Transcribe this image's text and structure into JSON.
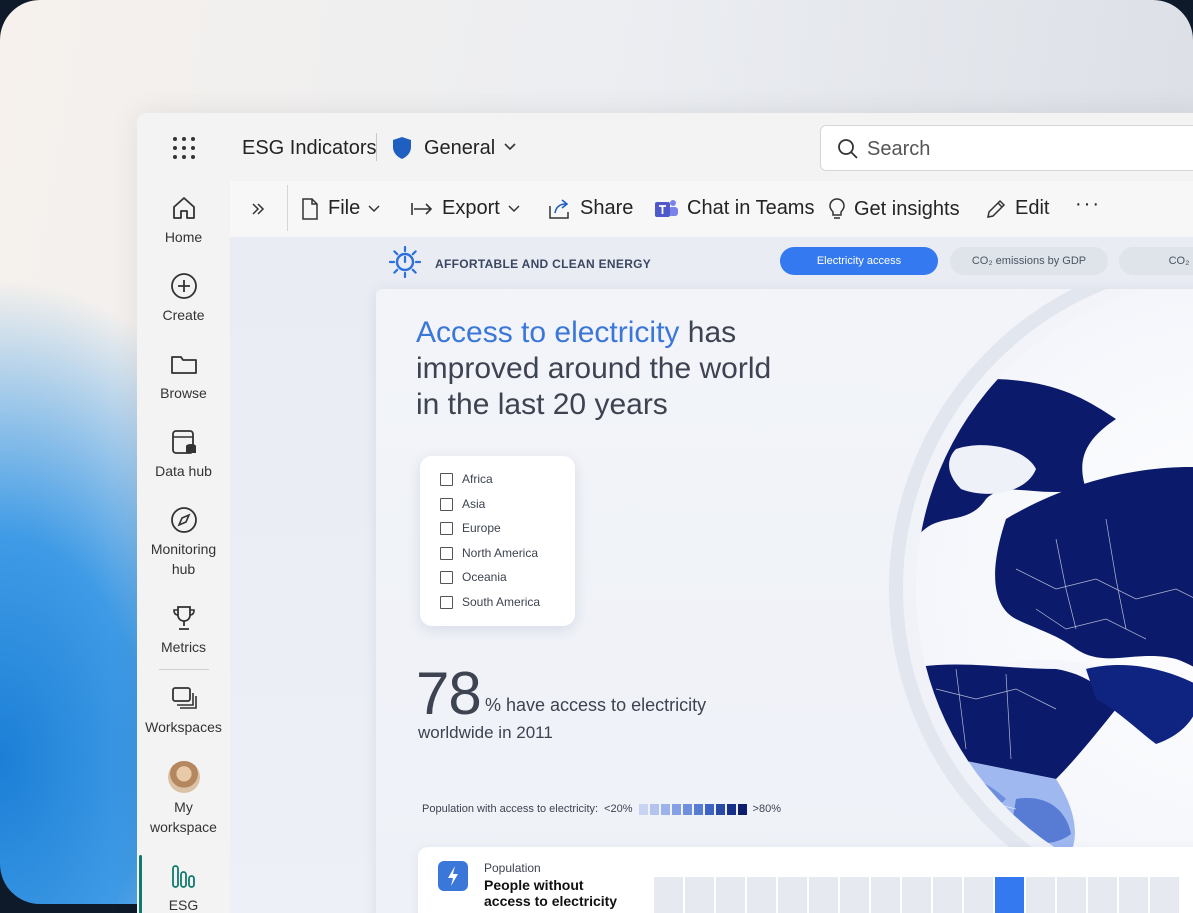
{
  "header": {
    "app_title": "ESG Indicators",
    "workspace": "General",
    "search_placeholder": "Search"
  },
  "nav": [
    {
      "label": "Home",
      "icon": "home-icon"
    },
    {
      "label": "Create",
      "icon": "plus-circle-icon"
    },
    {
      "label": "Browse",
      "icon": "folder-icon"
    },
    {
      "label": "Data hub",
      "icon": "data-hub-icon"
    },
    {
      "label": "Monitoring hub",
      "icon": "compass-icon"
    },
    {
      "label": "Metrics",
      "icon": "trophy-icon"
    },
    {
      "label": "Workspaces",
      "icon": "workspaces-icon"
    },
    {
      "label": "My workspace",
      "icon": "avatar"
    },
    {
      "label": "ESG",
      "icon": "bar-chart-icon"
    }
  ],
  "toolbar": {
    "file": "File",
    "export": "Export",
    "share": "Share",
    "chat": "Chat in Teams",
    "insights": "Get insights",
    "edit": "Edit",
    "more": "···"
  },
  "report": {
    "section_label": "AFFORTABLE AND CLEAN ENERGY",
    "tabs": [
      "Electricity access",
      "CO₂ emissions by GDP",
      "CO₂"
    ],
    "active_tab": "Electricity access",
    "headline_highlight": "Access to electricity",
    "headline_rest": " has improved around the world in the last 20 years",
    "regions": [
      "Africa",
      "Asia",
      "Europe",
      "North America",
      "Oceania",
      "South America"
    ],
    "kpi_value": "78",
    "kpi_unit": "% have access to electricity",
    "kpi_sub": "worldwide in 2011",
    "legend_label": "Population with access to electricity:",
    "legend_low": "<20%",
    "legend_high": ">80%",
    "legend_colors": [
      "#c8d4f3",
      "#b3c3ee",
      "#9db2ea",
      "#86a0e4",
      "#6f8edd",
      "#587bd4",
      "#3f63c4",
      "#2a4aa8",
      "#17308a",
      "#0d1f6b"
    ],
    "bottom_category": "Population",
    "bottom_title": "People without access to electricity"
  },
  "colors": {
    "accent": "#3579f0",
    "map_dark": "#0c1a6b",
    "map_mid": "#5b82e0",
    "map_light": "#9fb8f0"
  }
}
